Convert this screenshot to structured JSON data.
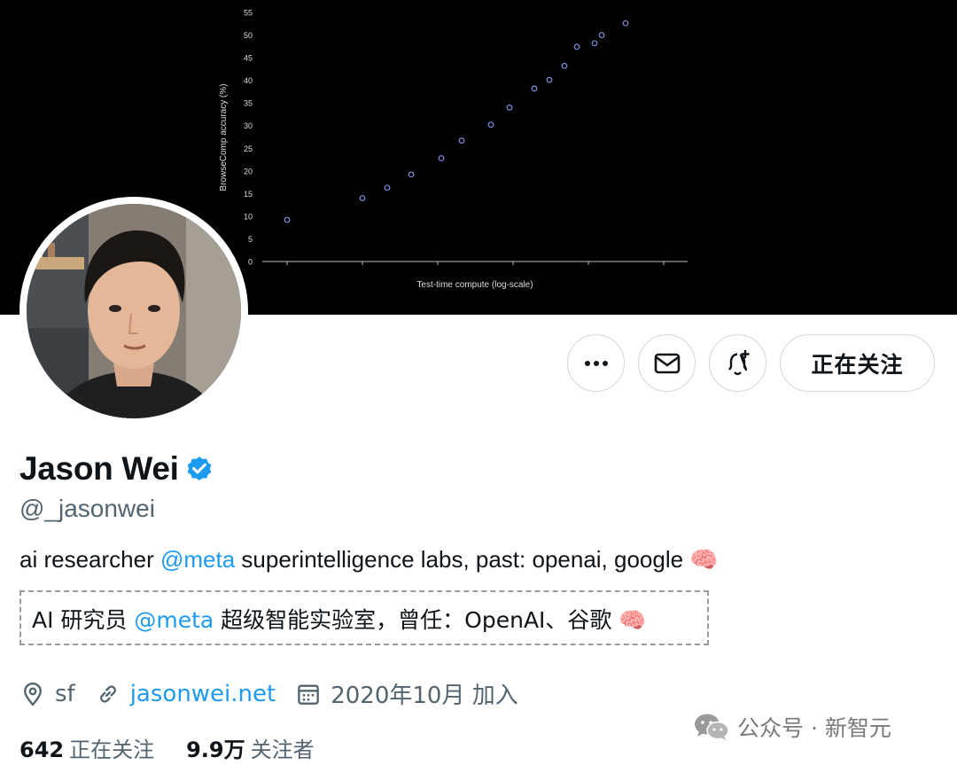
{
  "banner": {
    "chart_data": {
      "type": "scatter",
      "xlabel": "Test-time compute (log-scale)",
      "ylabel": "BrowseComp accuracy (%)",
      "ylim": [
        0,
        55
      ],
      "yticks": [
        "0",
        "5",
        "10",
        "15",
        "20",
        "25",
        "30",
        "35",
        "40",
        "45",
        "50",
        "55"
      ],
      "x_scale": "log",
      "x_tick_labels": "none",
      "colors": {
        "background": "#000000",
        "points": "#7f8fe0",
        "axes": "#bbbbbb",
        "text": "#dddddd"
      },
      "series": [
        {
          "values": [
            {
              "x": 1,
              "y": 9.2
            },
            {
              "x": 2,
              "y": 14.0
            },
            {
              "x": 3,
              "y": 16.3
            },
            {
              "x": 4,
              "y": 19.2
            },
            {
              "x": 5,
              "y": 22.8
            },
            {
              "x": 6,
              "y": 26.7
            },
            {
              "x": 7,
              "y": 30.2
            },
            {
              "x": 8,
              "y": 34.0
            },
            {
              "x": 9,
              "y": 38.2
            },
            {
              "x": 10,
              "y": 40.1
            },
            {
              "x": 11,
              "y": 43.2
            },
            {
              "x": 12,
              "y": 47.4
            },
            {
              "x": 13,
              "y": 48.2
            },
            {
              "x": 14,
              "y": 50.0
            },
            {
              "x": 15,
              "y": 52.6
            }
          ]
        }
      ]
    }
  },
  "actions": {
    "more_icon": "more-icon",
    "message_icon": "mail-icon",
    "subscribe_icon": "bell-plus-icon",
    "follow_label": "正在关注"
  },
  "profile": {
    "name": "Jason Wei",
    "verified": true,
    "handle": "@_jasonwei",
    "bio": {
      "before": "ai researcher ",
      "mention": "@meta",
      "after": " superintelligence labs, past: openai, google 🧠"
    },
    "translation": {
      "before": "AI 研究员 ",
      "mention": "@meta",
      "after": " 超级智能实验室，曾任：OpenAI、谷歌 🧠"
    },
    "location": "sf",
    "website": "jasonwei.net",
    "joined": "2020年10月 加入",
    "following_count": "642",
    "following_label": "正在关注",
    "followers_count": "9.9万",
    "followers_label": "关注者"
  },
  "watermark": {
    "text": "公众号 · 新智元"
  },
  "colors": {
    "accent": "#1d9bf0",
    "muted": "#536471",
    "text": "#0f1419",
    "border": "#cfd9de"
  }
}
